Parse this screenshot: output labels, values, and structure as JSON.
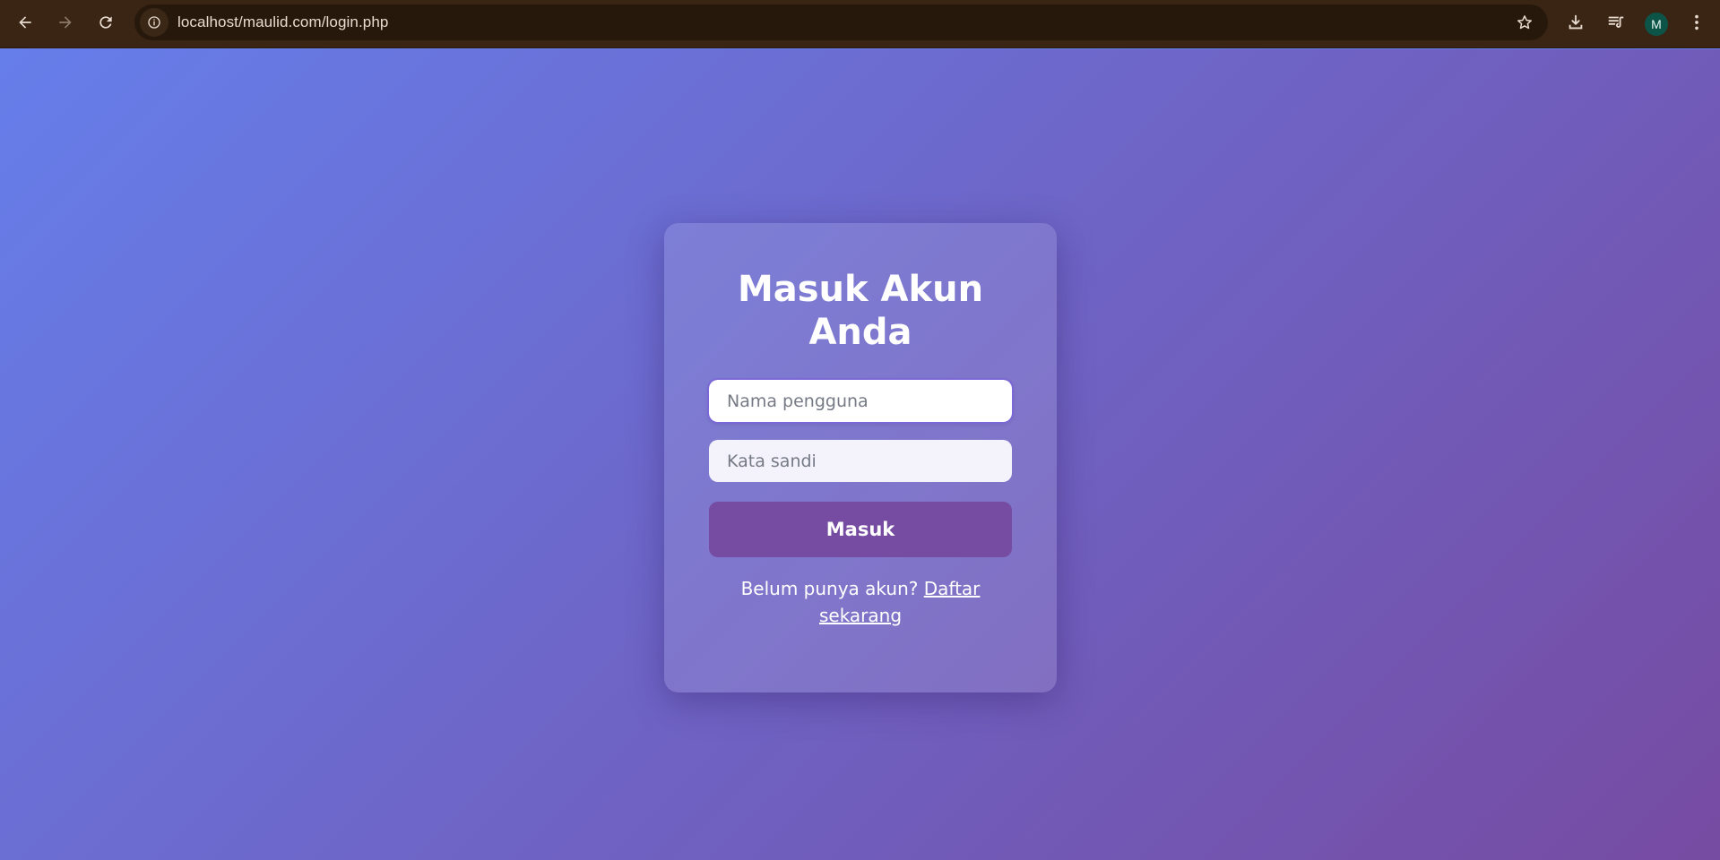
{
  "browser": {
    "url": "localhost/maulid.com/login.php",
    "profile_initial": "M",
    "profile_color": "#0c5448",
    "toolbar_color": "#3a2414",
    "icons": {
      "back": "arrow-left-icon",
      "forward": "arrow-right-icon",
      "reload": "reload-icon",
      "site_info": "info-icon",
      "bookmark": "star-icon",
      "download": "download-icon",
      "media": "media-queue-icon",
      "menu": "kebab-menu-icon"
    }
  },
  "page": {
    "gradient_start": "#667eea",
    "gradient_end": "#764ba2"
  },
  "login": {
    "title": "Masuk Akun Anda",
    "username_placeholder": "Nama pengguna",
    "password_placeholder": "Kata sandi",
    "submit_label": "Masuk",
    "register_prompt": "Belum punya akun?",
    "register_link": "Daftar sekarang",
    "button_color": "#764ba2"
  }
}
